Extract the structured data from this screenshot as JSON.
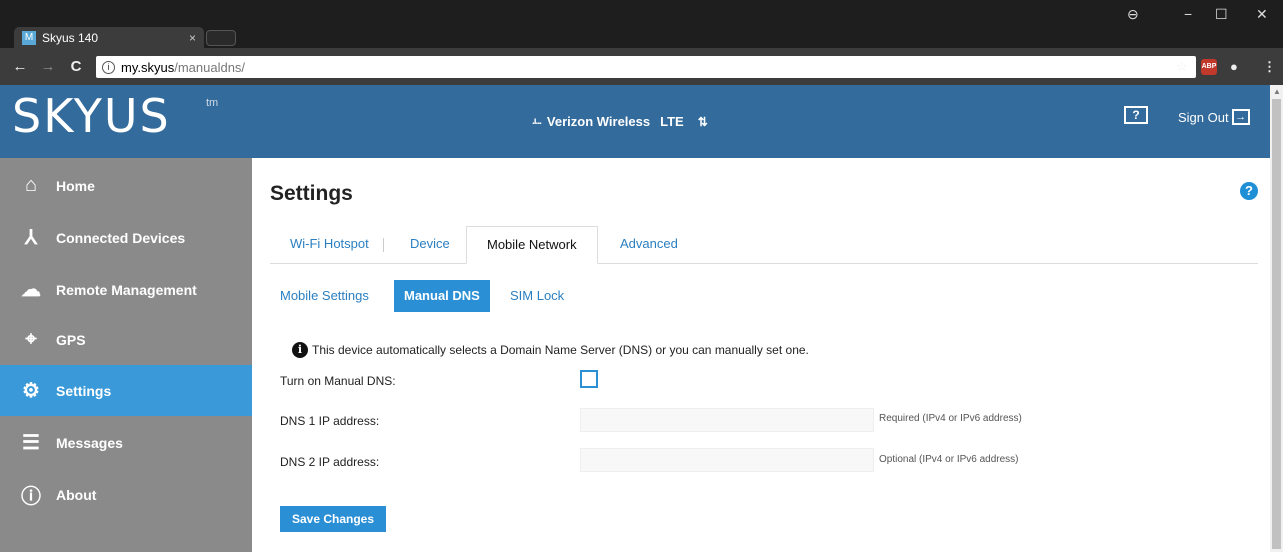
{
  "browser": {
    "tab_title": "Skyus 140",
    "tab_favicon": "M",
    "tab_close": "×",
    "url_host": "my.skyus",
    "url_path": "/manualdns/",
    "win_min": "−",
    "win_max": "☐",
    "win_close": "✕",
    "nav_back": "←",
    "nav_forward": "→",
    "nav_reload": "C",
    "abp_label": "ABP"
  },
  "header": {
    "logo": "SKYUS",
    "logo_tm": "tm",
    "signal_bars": ".ı...",
    "carrier": "Verizon Wireless",
    "network_type": "LTE",
    "help_label": "?",
    "sign_out": "Sign Out"
  },
  "sidebar": {
    "items": [
      {
        "label": "Home",
        "icon": "home-icon",
        "glyph": "⌂"
      },
      {
        "label": "Connected Devices",
        "icon": "connected-devices-icon",
        "glyph": "⅄"
      },
      {
        "label": "Remote Management",
        "icon": "cloud-icon",
        "glyph": "☁"
      },
      {
        "label": "GPS",
        "icon": "crosshair-icon",
        "glyph": "⌖"
      },
      {
        "label": "Settings",
        "icon": "gear-icon",
        "glyph": "⚙"
      },
      {
        "label": "Messages",
        "icon": "message-icon",
        "glyph": "☰"
      },
      {
        "label": "About",
        "icon": "info-icon",
        "glyph": "ⓘ"
      }
    ],
    "active_index": 4
  },
  "main": {
    "title": "Settings",
    "help_icon": "?",
    "tabs": [
      "Wi-Fi Hotspot",
      "Device",
      "Mobile Network",
      "Advanced"
    ],
    "active_tab": "Mobile Network",
    "subtabs": [
      "Mobile Settings",
      "Manual DNS",
      "SIM Lock"
    ],
    "active_subtab": "Manual DNS",
    "info_text": "This device automatically selects a Domain Name Server (DNS) or you can manually set one.",
    "form": {
      "manual_dns_label": "Turn on Manual DNS:",
      "manual_dns_checked": false,
      "dns1_label": "DNS 1 IP address:",
      "dns1_value": "",
      "dns1_hint": "Required (IPv4 or IPv6 address)",
      "dns2_label": "DNS 2 IP address:",
      "dns2_value": "",
      "dns2_hint": "Optional (IPv4 or IPv6 address)"
    },
    "save_label": "Save Changes"
  },
  "colors": {
    "header_blue": "#336b9c",
    "sidebar_gray": "#8a8a8a",
    "accent_blue": "#2b8fd6",
    "active_nav": "#3a9ad9"
  }
}
